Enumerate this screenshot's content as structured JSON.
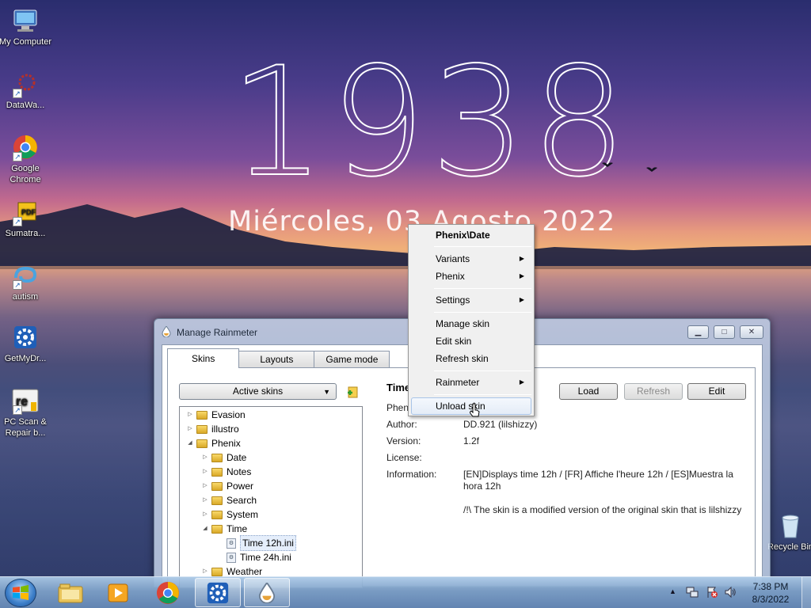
{
  "desktop": {
    "clock_digits": "1938",
    "date_text": "Miércoles, 03  Agosto  2022",
    "icons": [
      {
        "label": "My Computer",
        "icon": "computer-icon"
      },
      {
        "label": "DataWa...",
        "icon": "datawa-icon"
      },
      {
        "label": "Google Chrome",
        "icon": "chrome-icon"
      },
      {
        "label": "Sumatra...",
        "icon": "sumatra-pdf-icon"
      },
      {
        "label": "autism",
        "icon": "autism-icon"
      },
      {
        "label": "GetMyDr...",
        "icon": "getmydrivers-icon"
      },
      {
        "label": "PC Scan & Repair b...",
        "icon": "pc-scan-icon"
      }
    ],
    "recycle_bin": "Recycle Bin"
  },
  "window": {
    "title": "Manage Rainmeter",
    "controls": {
      "minimize": "▁",
      "maximize": "□",
      "close": "✕"
    },
    "tabs": [
      "Skins",
      "Layouts",
      "Game mode"
    ],
    "active_tab": "Skins",
    "dropdown": {
      "selected": "Active skins"
    },
    "tree": [
      {
        "label": "Evasion",
        "type": "folder",
        "level": 0,
        "expander": "▷"
      },
      {
        "label": "illustro",
        "type": "folder",
        "level": 0,
        "expander": "▷"
      },
      {
        "label": "Phenix",
        "type": "folder",
        "level": 0,
        "expander": "◢"
      },
      {
        "label": "Date",
        "type": "folder",
        "level": 1,
        "expander": "▷"
      },
      {
        "label": "Notes",
        "type": "folder",
        "level": 1,
        "expander": "▷"
      },
      {
        "label": "Power",
        "type": "folder",
        "level": 1,
        "expander": "▷"
      },
      {
        "label": "Search",
        "type": "folder",
        "level": 1,
        "expander": "▷"
      },
      {
        "label": "System",
        "type": "folder",
        "level": 1,
        "expander": "▷"
      },
      {
        "label": "Time",
        "type": "folder",
        "level": 1,
        "expander": "◢"
      },
      {
        "label": "Time 12h.ini",
        "type": "file",
        "level": 2,
        "expander": "",
        "selected": true
      },
      {
        "label": "Time 24h.ini",
        "type": "file",
        "level": 2,
        "expander": ""
      },
      {
        "label": "Weather",
        "type": "folder",
        "level": 1,
        "expander": "▷"
      }
    ],
    "details": {
      "title": "Time",
      "name_fragment": "Phen",
      "author_label": "Author:",
      "author_value": "DD.921 (lilshizzy)",
      "version_label": "Version:",
      "version_value": "1.2f",
      "license_label": "License:",
      "license_value": "",
      "information_label": "Information:",
      "information_line1": "[EN]Displays time 12h / [FR] Affiche l'heure 12h / [ES]Muestra la",
      "information_line2": "hora 12h",
      "information_line3": "/!\\ The skin is a modified version of the original skin that is lilshizzy"
    },
    "buttons": {
      "load": "Load",
      "refresh": "Refresh",
      "edit": "Edit"
    }
  },
  "context_menu": {
    "header": "Phenix\\Date",
    "items": [
      {
        "label": "Variants",
        "submenu": true
      },
      {
        "label": "Phenix",
        "submenu": true
      },
      {
        "label": "Settings",
        "submenu": true
      },
      {
        "label": "Manage skin",
        "submenu": false
      },
      {
        "label": "Edit skin",
        "submenu": false
      },
      {
        "label": "Refresh skin",
        "submenu": false
      },
      {
        "label": "Rainmeter",
        "submenu": true
      },
      {
        "label": "Unload skin",
        "submenu": false,
        "hovered": true
      }
    ],
    "submenu_arrow": "▶"
  },
  "taskbar": {
    "pinned": [
      "windows-explorer-icon",
      "media-player-icon",
      "chrome-icon",
      "getmydrivers-icon",
      "rainmeter-icon"
    ],
    "tray_arrow": "▲",
    "time": "7:38 PM",
    "date": "8/3/2022"
  }
}
